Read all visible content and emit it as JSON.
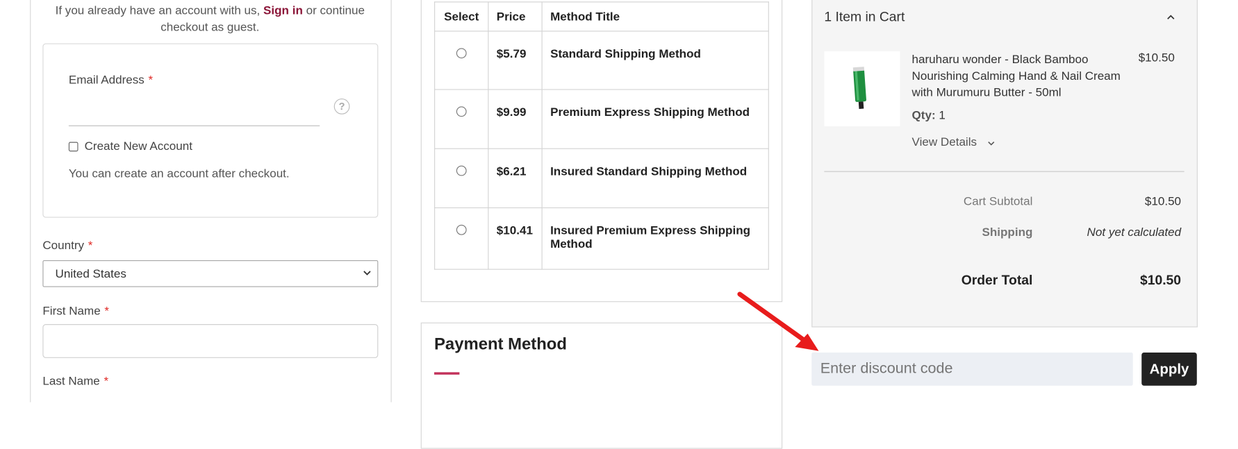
{
  "login_notice": {
    "prefix": "If you already have an account with us,",
    "link": "Sign in",
    "suffix": "or continue checkout as guest."
  },
  "email_section": {
    "label": "Email Address",
    "required_mark": "*",
    "help_icon": "question-circle-icon",
    "help_glyph": "?",
    "create_account_label": "Create New Account",
    "note": "You can create an account after checkout."
  },
  "address_form": {
    "country_label": "Country",
    "country_value": "United States",
    "first_name_label": "First Name",
    "last_name_label": "Last Name",
    "required_mark": "*"
  },
  "shipping": {
    "headers": [
      "Select",
      "Price",
      "Method Title"
    ],
    "methods": [
      {
        "price": "$5.79",
        "title": "Standard Shipping Method"
      },
      {
        "price": "$9.99",
        "title": "Premium Express Shipping Method"
      },
      {
        "price": "$6.21",
        "title": "Insured Standard Shipping Method"
      },
      {
        "price": "$10.41",
        "title": "Insured Premium Express Shipping Method"
      }
    ]
  },
  "payment": {
    "title": "Payment Method",
    "accent_color": "#c2315a"
  },
  "cart": {
    "header": "1 Item in Cart",
    "toggle_icon": "chevron-up-icon",
    "product": {
      "name": "haruharu wonder - Black Bamboo Nourishing Calming Hand & Nail Cream with Murumuru Butter - 50ml",
      "price": "$10.50",
      "qty_label": "Qty:",
      "qty_value": "1",
      "details_label": "View Details",
      "details_icon": "chevron-down-icon"
    },
    "totals": {
      "subtotal_label": "Cart Subtotal",
      "subtotal_value": "$10.50",
      "shipping_label": "Shipping",
      "shipping_value": "Not yet calculated",
      "order_total_label": "Order Total",
      "order_total_value": "$10.50"
    }
  },
  "discount": {
    "placeholder": "Enter discount code",
    "apply_label": "Apply"
  },
  "annotation": {
    "arrow_color": "#e81c1c"
  }
}
